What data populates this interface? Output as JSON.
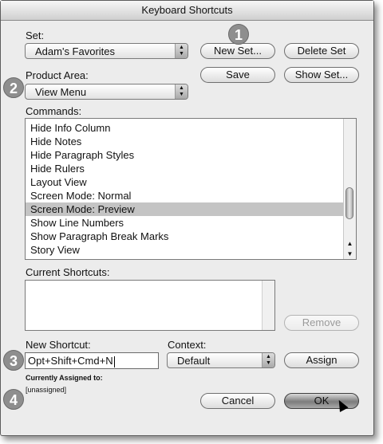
{
  "window": {
    "title": "Keyboard Shortcuts"
  },
  "set": {
    "label": "Set:",
    "value": "Adam's Favorites"
  },
  "buttons": {
    "new_set": "New Set...",
    "delete_set": "Delete Set",
    "save": "Save",
    "show_set": "Show Set...",
    "remove": "Remove",
    "assign": "Assign",
    "cancel": "Cancel",
    "ok": "OK"
  },
  "product_area": {
    "label": "Product Area:",
    "value": "View Menu"
  },
  "commands": {
    "label": "Commands:",
    "items": [
      "Hide Info Column",
      "Hide Notes",
      "Hide Paragraph Styles",
      "Hide Rulers",
      "Layout View",
      "Screen Mode: Normal",
      "Screen Mode: Preview",
      "Show Line Numbers",
      "Show Paragraph Break Marks",
      "Story View"
    ],
    "selected": "Screen Mode: Preview",
    "scroll_fraction": 0.8
  },
  "current_shortcuts": {
    "label": "Current Shortcuts:"
  },
  "new_shortcut": {
    "label": "New Shortcut:",
    "value": "Opt+Shift+Cmd+N"
  },
  "context": {
    "label": "Context:",
    "value": "Default"
  },
  "assigned": {
    "label": "Currently Assigned to:",
    "value": "[unassigned]"
  },
  "callouts": [
    "1",
    "2",
    "3",
    "4"
  ]
}
